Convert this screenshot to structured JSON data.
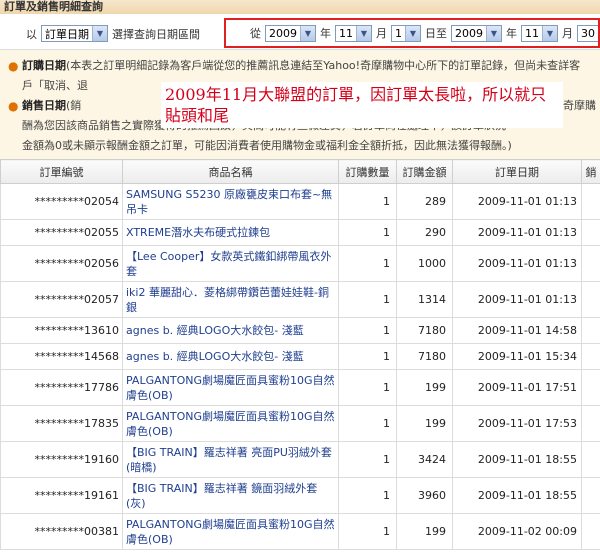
{
  "page_title": "訂單及銷售明細查詢",
  "filter": {
    "prefix": "以",
    "type_select": "訂單日期",
    "range_label": "選擇查詢日期區間",
    "from_label": "從",
    "from_year": "2009",
    "year_label": "年",
    "from_month": "11",
    "month_label": "月",
    "from_day": "1",
    "day_label": "日至",
    "to_year": "2009",
    "to_month": "11",
    "to_day": "30"
  },
  "notice": {
    "line1_label": "訂購日期",
    "line1_text": "(本表之訂單明細記錄為客戶端從您的推薦訊息連結至Yahoo!奇摩購物中心所下的訂單記錄，但尚未查詳客",
    "line2_text": "戶「取消、退",
    "line3_label": "銷售日期",
    "line3_text": "(銷",
    "line3_tail": "奇摩購",
    "line4_text": "酬為您因該商品銷售之實際獲得的推薦回饋，其間可能有些微差異，若訂單尚在處理中，該訂單狀況",
    "line5_text": "金額為0或未顯示報酬金額之訂單，可能因消費者使用購物金或福利金全額折抵，因此無法獲得報酬。)",
    "overlay": "2009年11月大聯盟的訂單，因訂單太長啦，所以就只貼頭和尾"
  },
  "table": {
    "headers": [
      "訂單編號",
      "商品名稱",
      "訂購數量",
      "訂購金額",
      "訂單日期",
      "銷"
    ],
    "rows": [
      {
        "order": "*********02054",
        "product": "SAMSUNG S5230 原廠甕皮束口布套~無吊卡",
        "qty": "1",
        "amount": "289",
        "date": "2009-11-01 01:13"
      },
      {
        "order": "*********02055",
        "product": "XTREME潛水夫布硬式拉鍊包",
        "qty": "1",
        "amount": "290",
        "date": "2009-11-01 01:13"
      },
      {
        "order": "*********02056",
        "product": "【Lee Cooper】女款英式鐵釦綁帶風衣外套",
        "qty": "1",
        "amount": "1000",
        "date": "2009-11-01 01:13"
      },
      {
        "order": "*********02057",
        "product": "iki2 華麗甜心．菱格綁帶鑽芭蕾娃娃鞋-銅銀",
        "qty": "1",
        "amount": "1314",
        "date": "2009-11-01 01:13"
      },
      {
        "order": "*********13610",
        "product": "agnes b. 經典LOGO大水餃包- 淺藍",
        "qty": "1",
        "amount": "7180",
        "date": "2009-11-01 14:58"
      },
      {
        "order": "*********14568",
        "product": "agnes b. 經典LOGO大水餃包- 淺藍",
        "qty": "1",
        "amount": "7180",
        "date": "2009-11-01 15:34"
      },
      {
        "order": "*********17786",
        "product": "PALGANTONG劇場魔匠面具蜜粉10G自然膚色(OB)",
        "qty": "1",
        "amount": "199",
        "date": "2009-11-01 17:51"
      },
      {
        "order": "*********17835",
        "product": "PALGANTONG劇場魔匠面具蜜粉10G自然膚色(OB)",
        "qty": "1",
        "amount": "199",
        "date": "2009-11-01 17:53"
      },
      {
        "order": "*********19160",
        "product": "【BIG TRAIN】羅志祥著 亮面PU羽絨外套(暗橋)",
        "qty": "1",
        "amount": "3424",
        "date": "2009-11-01 18:55"
      },
      {
        "order": "*********19161",
        "product": "【BIG TRAIN】羅志祥著 鏡面羽絨外套(灰)",
        "qty": "1",
        "amount": "3960",
        "date": "2009-11-01 18:55"
      },
      {
        "order": "*********00381",
        "product": "PALGANTONG劇場魔匠面具蜜粉10G自然膚色(OB)",
        "qty": "1",
        "amount": "199",
        "date": "2009-11-02 00:09"
      }
    ]
  }
}
